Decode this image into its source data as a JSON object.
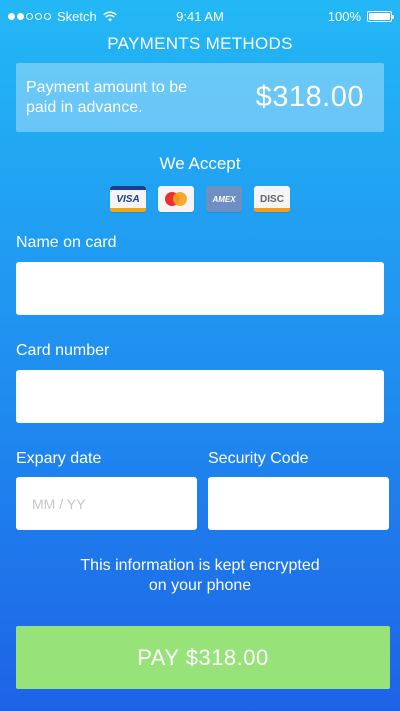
{
  "status_bar": {
    "carrier": "Sketch",
    "time": "9:41 AM",
    "battery_text": "100%",
    "battery_level": 1.0,
    "signal_bars_filled": 2,
    "signal_bars_total": 5,
    "icons": [
      "signal-dots-icon",
      "wifi-icon",
      "battery-icon"
    ]
  },
  "header": {
    "title": "PAYMENTS METHODS"
  },
  "amount": {
    "label": "Payment amount to be paid in advance.",
    "value": "$318.00"
  },
  "accept": {
    "title": "We Accept",
    "cards": [
      {
        "name": "visa-icon",
        "text": "VISA"
      },
      {
        "name": "mastercard-icon",
        "text": ""
      },
      {
        "name": "amex-icon",
        "text": "AMEX"
      },
      {
        "name": "discover-icon",
        "text": "DISC"
      }
    ]
  },
  "form": {
    "name_label": "Name on card",
    "name_value": "",
    "card_label": "Card number",
    "card_value": "",
    "expiry_label": "Expary date",
    "expiry_placeholder": "MM / YY",
    "security_label": "Security Code",
    "security_value": ""
  },
  "info": {
    "line1": "This information is kept encrypted",
    "line2": "on your phone"
  },
  "pay_button": {
    "label": "PAY $318.00",
    "color": "#98e27a"
  },
  "colors": {
    "gradient_top": "#23b8f5",
    "gradient_bottom": "#1d63e6",
    "pay_green": "#98e27a"
  }
}
